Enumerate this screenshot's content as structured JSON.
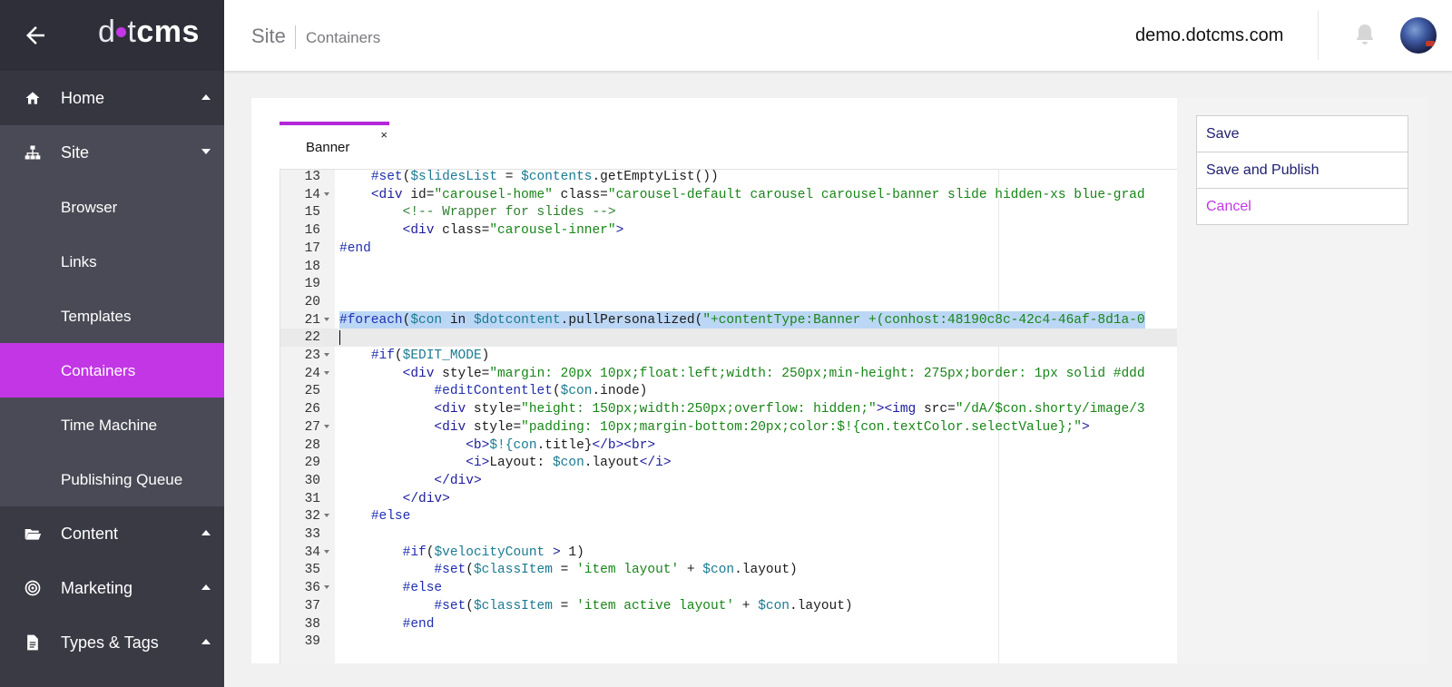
{
  "brand": {
    "logo_dot": "d",
    "logo_tail": "t",
    "logo_cms": "cms"
  },
  "sidebar": {
    "items": [
      {
        "label": "Home",
        "icon": "home-icon"
      },
      {
        "label": "Site",
        "icon": "sitemap-icon"
      },
      {
        "label": "Content",
        "icon": "folder-open-icon"
      },
      {
        "label": "Marketing",
        "icon": "target-icon"
      },
      {
        "label": "Types & Tags",
        "icon": "file-icon"
      }
    ],
    "site_subitems": [
      "Browser",
      "Links",
      "Templates",
      "Containers",
      "Time Machine",
      "Publishing Queue"
    ],
    "active_subitem": "Containers"
  },
  "header": {
    "section": "Site",
    "page": "Containers",
    "site_name": "demo.dotcms.com"
  },
  "editor": {
    "tab_label": "Banner",
    "tab_close": "×",
    "lines": [
      {
        "n": "13",
        "fold": false,
        "text": "    #set($slidesList = $contents.getEmptyList())"
      },
      {
        "n": "14",
        "fold": true,
        "text": "    <div id=\"carousel-home\" class=\"carousel-default carousel carousel-banner slide hidden-xs blue-grad"
      },
      {
        "n": "15",
        "fold": false,
        "text": "        <!-- Wrapper for slides -->"
      },
      {
        "n": "16",
        "fold": false,
        "text": "        <div class=\"carousel-inner\">"
      },
      {
        "n": "17",
        "fold": false,
        "text": "#end"
      },
      {
        "n": "18",
        "fold": false,
        "text": ""
      },
      {
        "n": "19",
        "fold": false,
        "text": ""
      },
      {
        "n": "20",
        "fold": false,
        "text": ""
      },
      {
        "n": "21",
        "fold": true,
        "text": "#foreach($con in $dotcontent.pullPersonalized(\"+contentType:Banner +(conhost:48190c8c-42c4-46af-8d1a-0"
      },
      {
        "n": "22",
        "fold": false,
        "text": ""
      },
      {
        "n": "23",
        "fold": true,
        "text": "    #if($EDIT_MODE)"
      },
      {
        "n": "24",
        "fold": true,
        "text": "        <div style=\"margin: 20px 10px;float:left;width: 250px;min-height: 275px;border: 1px solid #ddd"
      },
      {
        "n": "25",
        "fold": false,
        "text": "            #editContentlet($con.inode)"
      },
      {
        "n": "26",
        "fold": false,
        "text": "            <div style=\"height: 150px;width:250px;overflow: hidden;\"><img src=\"/dA/$con.shorty/image/3"
      },
      {
        "n": "27",
        "fold": true,
        "text": "            <div style=\"padding: 10px;margin-bottom:20px;color:$!{con.textColor.selectValue};\">"
      },
      {
        "n": "28",
        "fold": false,
        "text": "                <b>$!{con.title}</b><br>"
      },
      {
        "n": "29",
        "fold": false,
        "text": "                <i>Layout: $con.layout</i>"
      },
      {
        "n": "30",
        "fold": false,
        "text": "            </div>"
      },
      {
        "n": "31",
        "fold": false,
        "text": "        </div>"
      },
      {
        "n": "32",
        "fold": true,
        "text": "    #else"
      },
      {
        "n": "33",
        "fold": false,
        "text": ""
      },
      {
        "n": "34",
        "fold": true,
        "text": "        #if($velocityCount > 1)"
      },
      {
        "n": "35",
        "fold": false,
        "text": "            #set($classItem = 'item layout' + $con.layout)"
      },
      {
        "n": "36",
        "fold": true,
        "text": "        #else"
      },
      {
        "n": "37",
        "fold": false,
        "text": "            #set($classItem = 'item active layout' + $con.layout)"
      },
      {
        "n": "38",
        "fold": false,
        "text": "        #end"
      },
      {
        "n": "39",
        "fold": false,
        "text": ""
      }
    ],
    "selected_line": "21",
    "cursor_line": "22"
  },
  "actions": {
    "save": "Save",
    "save_publish": "Save and Publish",
    "cancel": "Cancel"
  },
  "colors": {
    "accent": "#c336e5",
    "sidebar_bg": "#3a3a45",
    "sidebar_sub_bg": "#4a4a56",
    "selection": "#bcd7f5"
  }
}
